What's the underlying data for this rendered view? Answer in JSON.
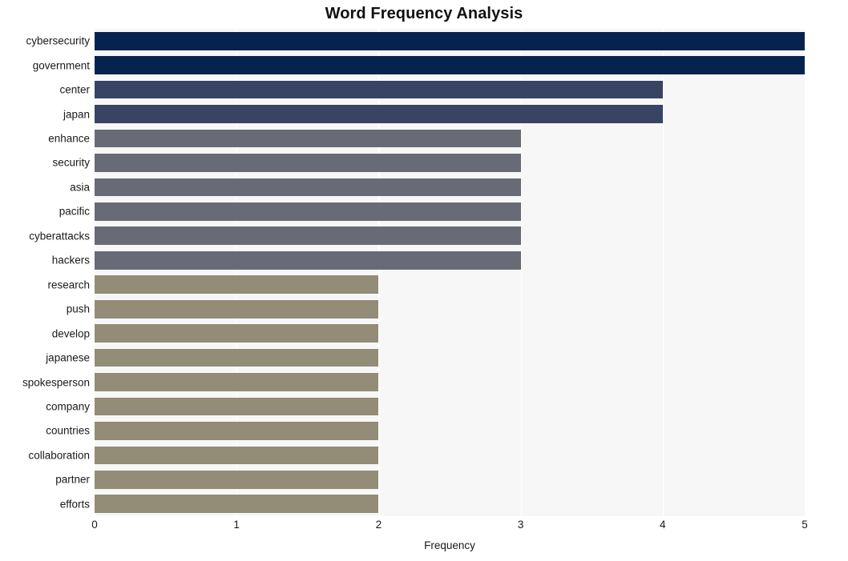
{
  "chart_data": {
    "type": "bar",
    "orientation": "horizontal",
    "title": "Word Frequency Analysis",
    "xlabel": "Frequency",
    "ylabel": "",
    "xlim": [
      0,
      5
    ],
    "xticks": [
      "0",
      "1",
      "2",
      "3",
      "4",
      "5"
    ],
    "grid": true,
    "legend": false,
    "categories": [
      "cybersecurity",
      "government",
      "center",
      "japan",
      "enhance",
      "security",
      "asia",
      "pacific",
      "cyberattacks",
      "hackers",
      "research",
      "push",
      "develop",
      "japanese",
      "spokesperson",
      "company",
      "countries",
      "collaboration",
      "partner",
      "efforts"
    ],
    "values": [
      5,
      5,
      4,
      4,
      3,
      3,
      3,
      3,
      3,
      3,
      2,
      2,
      2,
      2,
      2,
      2,
      2,
      2,
      2,
      2
    ],
    "bar_colors": [
      "#062350",
      "#062350",
      "#394465",
      "#394465",
      "#686b76",
      "#686b76",
      "#686b76",
      "#686b76",
      "#686b76",
      "#686b76",
      "#938c76",
      "#938c76",
      "#938c76",
      "#938c76",
      "#938c76",
      "#938c76",
      "#938c76",
      "#938c76",
      "#938c76",
      "#938c76"
    ],
    "plot_background": "#f7f7f7",
    "figure_background": "#ffffff",
    "gridline_color": "#ffffff"
  }
}
